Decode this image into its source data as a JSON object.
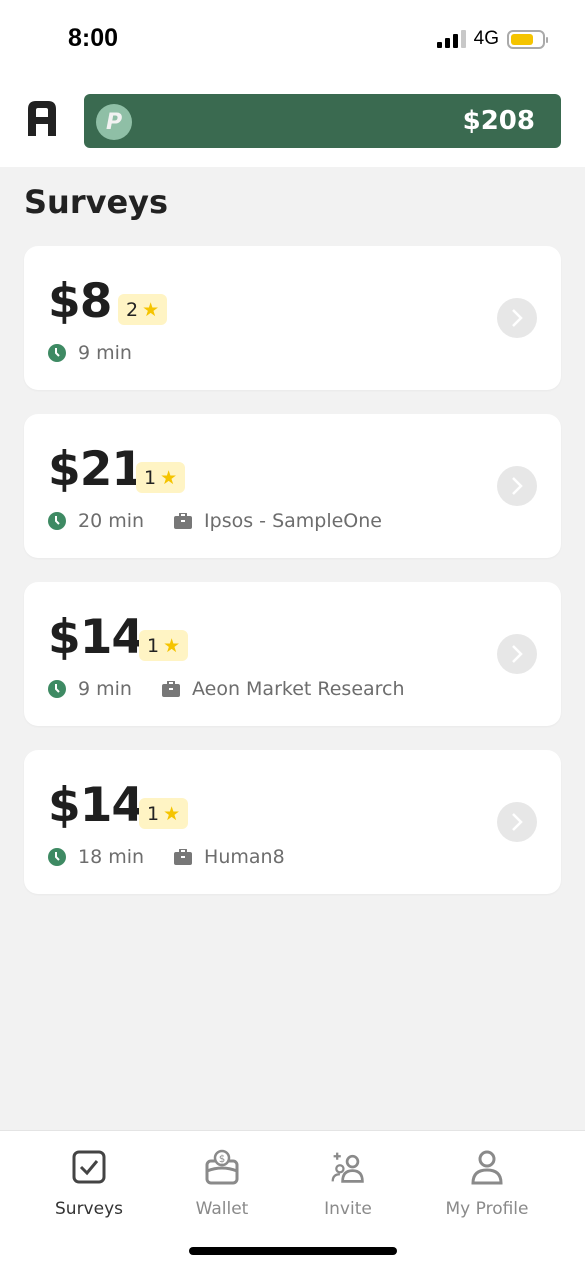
{
  "status_bar": {
    "time": "8:00",
    "network": "4G",
    "battery_color": "#f5c400"
  },
  "header": {
    "logo_letter": "A",
    "wallet_icon": "paypal-icon",
    "balance": "$208",
    "brand_color": "#3a6a50"
  },
  "page": {
    "title": "Surveys"
  },
  "surveys": [
    {
      "amount": "$8",
      "rating": "2",
      "duration": "9 min",
      "provider": ""
    },
    {
      "amount": "$21",
      "rating": "1",
      "duration": "20 min",
      "provider": "Ipsos - SampleOne"
    },
    {
      "amount": "$14",
      "rating": "1",
      "duration": "9 min",
      "provider": "Aeon Market Research"
    },
    {
      "amount": "$14",
      "rating": "1",
      "duration": "18 min",
      "provider": "Human8"
    }
  ],
  "tabs": [
    {
      "label": "Surveys",
      "icon": "checkbox-icon",
      "active": true
    },
    {
      "label": "Wallet",
      "icon": "wallet-icon",
      "active": false
    },
    {
      "label": "Invite",
      "icon": "add-users-icon",
      "active": false
    },
    {
      "label": "My Profile",
      "icon": "profile-icon",
      "active": false
    }
  ]
}
